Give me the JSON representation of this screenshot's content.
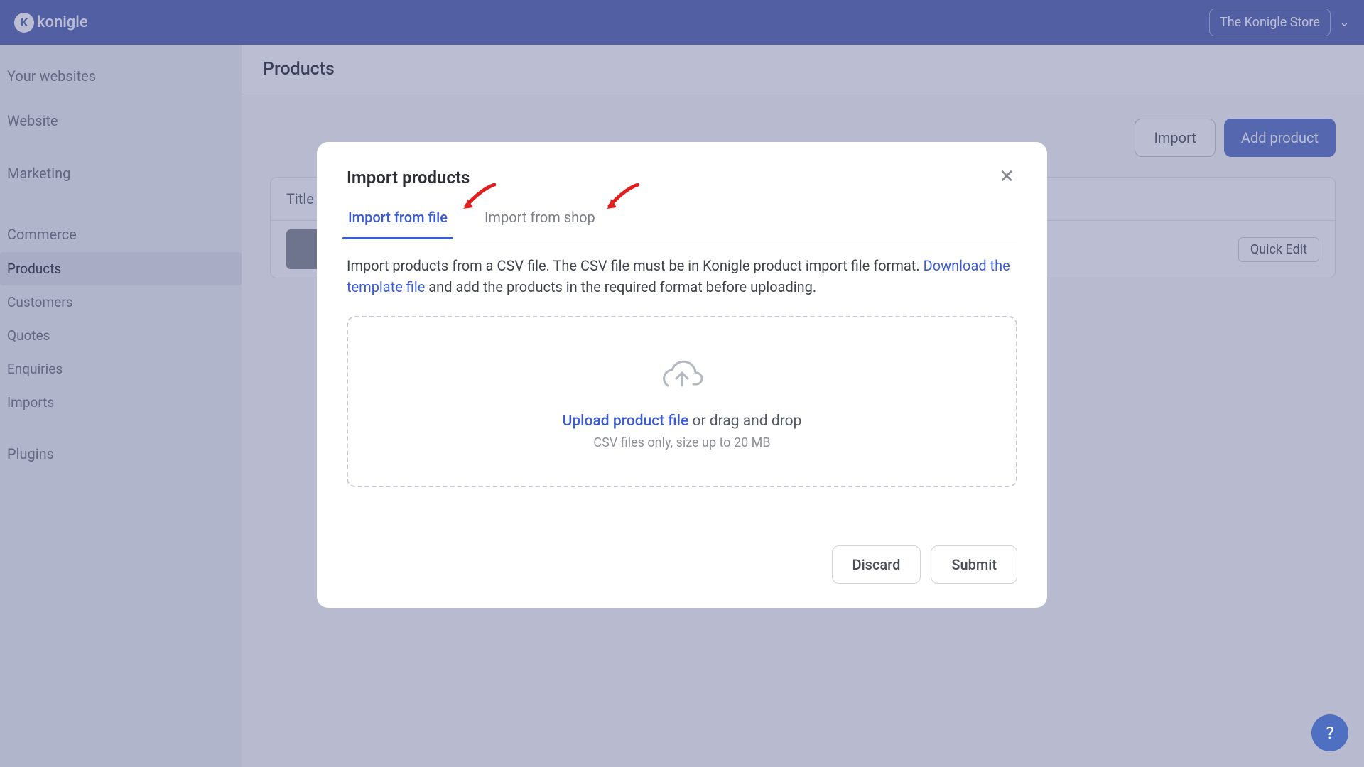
{
  "topbar": {
    "logo_text": "konigle",
    "store_name": "The Konigle Store"
  },
  "sidebar": {
    "heading": "Your websites",
    "items": [
      {
        "label": "Website"
      },
      {
        "label": "Marketing"
      },
      {
        "label": "Commerce",
        "sub": [
          {
            "label": "Products",
            "active": true
          },
          {
            "label": "Customers"
          },
          {
            "label": "Quotes"
          },
          {
            "label": "Enquiries"
          },
          {
            "label": "Imports"
          }
        ]
      },
      {
        "label": "Plugins"
      }
    ]
  },
  "page": {
    "title": "Products",
    "import_btn": "Import",
    "add_btn": "Add product",
    "table_heading": "Title",
    "quick_edit": "Quick Edit"
  },
  "modal": {
    "title": "Import products",
    "tabs": [
      {
        "label": "Import from file",
        "active": true
      },
      {
        "label": "Import from shop"
      }
    ],
    "desc_1": "Import products from a CSV file. The CSV file must be in Konigle product import file format. ",
    "download_link": "Download the template file",
    "desc_2": " and add the products in the required format before uploading.",
    "upload_link": "Upload product file",
    "upload_suffix": " or drag and drop",
    "upload_hint": "CSV files only, size up to 20 MB",
    "discard": "Discard",
    "submit": "Submit"
  }
}
